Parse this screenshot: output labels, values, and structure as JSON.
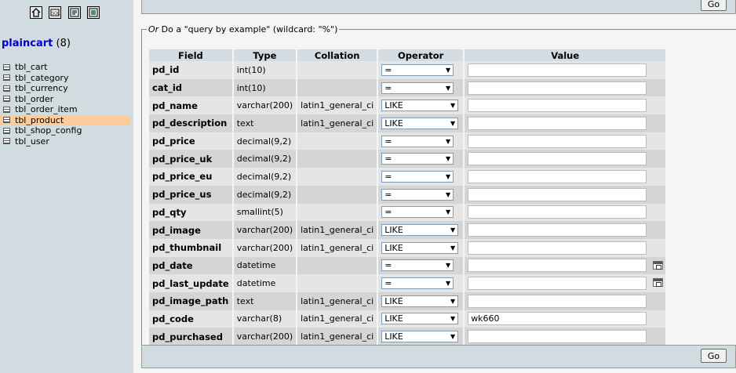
{
  "nav": {
    "icons": [
      "home-icon",
      "sql-icon",
      "query-window-icon",
      "docs-icon"
    ],
    "db_name": "plaincart",
    "db_count": "(8)",
    "tables": [
      "tbl_cart",
      "tbl_category",
      "tbl_currency",
      "tbl_order",
      "tbl_order_item",
      "tbl_product",
      "tbl_shop_config",
      "tbl_user"
    ],
    "selected_table": "tbl_product"
  },
  "buttons": {
    "go_top": "Go",
    "go_bottom": "Go"
  },
  "qbe": {
    "legend_prefix": "Or",
    "legend_text": " Do a \"query by example\" (wildcard: \"%\")",
    "headers": [
      "Field",
      "Type",
      "Collation",
      "Operator",
      "Value"
    ],
    "rows": [
      {
        "field": "pd_id",
        "type": "int(10)",
        "collation": "",
        "operator": "=",
        "value": ""
      },
      {
        "field": "cat_id",
        "type": "int(10)",
        "collation": "",
        "operator": "=",
        "value": ""
      },
      {
        "field": "pd_name",
        "type": "varchar(200)",
        "collation": "latin1_general_ci",
        "operator": "LIKE",
        "value": ""
      },
      {
        "field": "pd_description",
        "type": "text",
        "collation": "latin1_general_ci",
        "operator": "LIKE",
        "value": ""
      },
      {
        "field": "pd_price",
        "type": "decimal(9,2)",
        "collation": "",
        "operator": "=",
        "value": ""
      },
      {
        "field": "pd_price_uk",
        "type": "decimal(9,2)",
        "collation": "",
        "operator": "=",
        "value": ""
      },
      {
        "field": "pd_price_eu",
        "type": "decimal(9,2)",
        "collation": "",
        "operator": "=",
        "value": ""
      },
      {
        "field": "pd_price_us",
        "type": "decimal(9,2)",
        "collation": "",
        "operator": "=",
        "value": ""
      },
      {
        "field": "pd_qty",
        "type": "smallint(5)",
        "collation": "",
        "operator": "=",
        "value": ""
      },
      {
        "field": "pd_image",
        "type": "varchar(200)",
        "collation": "latin1_general_ci",
        "operator": "LIKE",
        "value": ""
      },
      {
        "field": "pd_thumbnail",
        "type": "varchar(200)",
        "collation": "latin1_general_ci",
        "operator": "LIKE",
        "value": ""
      },
      {
        "field": "pd_date",
        "type": "datetime",
        "collation": "",
        "operator": "=",
        "value": "",
        "calendar": true
      },
      {
        "field": "pd_last_update",
        "type": "datetime",
        "collation": "",
        "operator": "=",
        "value": "",
        "calendar": true
      },
      {
        "field": "pd_image_path",
        "type": "text",
        "collation": "latin1_general_ci",
        "operator": "LIKE",
        "value": ""
      },
      {
        "field": "pd_code",
        "type": "varchar(8)",
        "collation": "latin1_general_ci",
        "operator": "LIKE",
        "value": "wk660"
      },
      {
        "field": "pd_purchased",
        "type": "varchar(200)",
        "collation": "latin1_general_ci",
        "operator": "LIKE",
        "value": ""
      }
    ]
  },
  "colors": {
    "nav_bg": "#d0dce0",
    "selected_bg": "#ffcc99",
    "header_bg": "#d3dce3",
    "row_odd": "#e5e5e5",
    "row_even": "#d5d5d5",
    "db_name_color": "#0000c0"
  }
}
